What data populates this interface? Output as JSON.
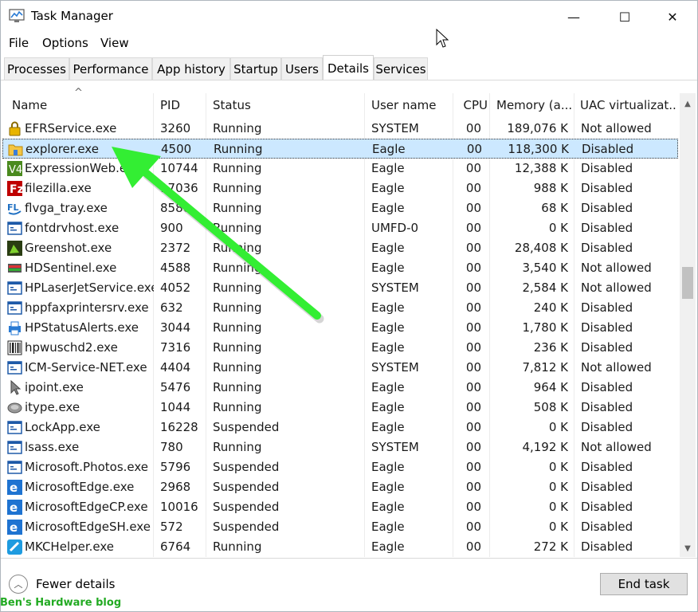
{
  "window": {
    "title": "Task Manager",
    "minimize": "—",
    "maximize": "☐",
    "close": "✕"
  },
  "menu": [
    "File",
    "Options",
    "View"
  ],
  "tabs": [
    "Processes",
    "Performance",
    "App history",
    "Startup",
    "Users",
    "Details",
    "Services"
  ],
  "active_tab": "Details",
  "columns": {
    "name": "Name",
    "pid": "PID",
    "status": "Status",
    "user": "User name",
    "cpu": "CPU",
    "memory": "Memory (a...",
    "uac": "UAC virtualizat..."
  },
  "sort_indicator": "^",
  "rows": [
    {
      "name": "EFRService.exe",
      "pid": "3260",
      "status": "Running",
      "user": "SYSTEM",
      "cpu": "00",
      "memory": "189,076 K",
      "uac": "Not allowed",
      "icon": "lock-icon",
      "selected": false
    },
    {
      "name": "explorer.exe",
      "pid": "4500",
      "status": "Running",
      "user": "Eagle",
      "cpu": "00",
      "memory": "118,300 K",
      "uac": "Disabled",
      "icon": "folder-icon",
      "selected": true
    },
    {
      "name": "ExpressionWeb.exe",
      "pid": "10744",
      "status": "Running",
      "user": "Eagle",
      "cpu": "00",
      "memory": "12,388 K",
      "uac": "Disabled",
      "icon": "expression-web-icon",
      "selected": false
    },
    {
      "name": "filezilla.exe",
      "pid": "17036",
      "status": "Running",
      "user": "Eagle",
      "cpu": "00",
      "memory": "988 K",
      "uac": "Disabled",
      "icon": "filezilla-icon",
      "selected": false
    },
    {
      "name": "flvga_tray.exe",
      "pid": "8580",
      "status": "Running",
      "user": "Eagle",
      "cpu": "00",
      "memory": "68 K",
      "uac": "Disabled",
      "icon": "flvga-icon",
      "selected": false
    },
    {
      "name": "fontdrvhost.exe",
      "pid": "900",
      "status": "Running",
      "user": "UMFD-0",
      "cpu": "00",
      "memory": "0 K",
      "uac": "Disabled",
      "icon": "window-app-icon",
      "selected": false
    },
    {
      "name": "Greenshot.exe",
      "pid": "2372",
      "status": "Running",
      "user": "Eagle",
      "cpu": "00",
      "memory": "28,408 K",
      "uac": "Disabled",
      "icon": "greenshot-icon",
      "selected": false
    },
    {
      "name": "HDSentinel.exe",
      "pid": "4588",
      "status": "Running",
      "user": "Eagle",
      "cpu": "00",
      "memory": "3,540 K",
      "uac": "Not allowed",
      "icon": "hdsentinel-icon",
      "selected": false
    },
    {
      "name": "HPLaserJetService.exe",
      "pid": "4052",
      "status": "Running",
      "user": "SYSTEM",
      "cpu": "00",
      "memory": "2,584 K",
      "uac": "Not allowed",
      "icon": "window-app-icon",
      "selected": false
    },
    {
      "name": "hppfaxprintersrv.exe",
      "pid": "632",
      "status": "Running",
      "user": "Eagle",
      "cpu": "00",
      "memory": "240 K",
      "uac": "Disabled",
      "icon": "window-app-icon",
      "selected": false
    },
    {
      "name": "HPStatusAlerts.exe",
      "pid": "3044",
      "status": "Running",
      "user": "Eagle",
      "cpu": "00",
      "memory": "1,780 K",
      "uac": "Disabled",
      "icon": "printer-icon",
      "selected": false
    },
    {
      "name": "hpwuschd2.exe",
      "pid": "7316",
      "status": "Running",
      "user": "Eagle",
      "cpu": "00",
      "memory": "236 K",
      "uac": "Disabled",
      "icon": "barcode-icon",
      "selected": false
    },
    {
      "name": "ICM-Service-NET.exe",
      "pid": "4404",
      "status": "Running",
      "user": "SYSTEM",
      "cpu": "00",
      "memory": "7,812 K",
      "uac": "Not allowed",
      "icon": "window-app-icon",
      "selected": false
    },
    {
      "name": "ipoint.exe",
      "pid": "5476",
      "status": "Running",
      "user": "Eagle",
      "cpu": "00",
      "memory": "964 K",
      "uac": "Disabled",
      "icon": "pointer-icon",
      "selected": false
    },
    {
      "name": "itype.exe",
      "pid": "1044",
      "status": "Running",
      "user": "Eagle",
      "cpu": "00",
      "memory": "508 K",
      "uac": "Disabled",
      "icon": "keyboard-icon",
      "selected": false
    },
    {
      "name": "LockApp.exe",
      "pid": "16228",
      "status": "Suspended",
      "user": "Eagle",
      "cpu": "00",
      "memory": "0 K",
      "uac": "Disabled",
      "icon": "window-app-icon",
      "selected": false
    },
    {
      "name": "lsass.exe",
      "pid": "780",
      "status": "Running",
      "user": "SYSTEM",
      "cpu": "00",
      "memory": "4,192 K",
      "uac": "Not allowed",
      "icon": "window-app-icon",
      "selected": false
    },
    {
      "name": "Microsoft.Photos.exe",
      "pid": "5796",
      "status": "Suspended",
      "user": "Eagle",
      "cpu": "00",
      "memory": "0 K",
      "uac": "Disabled",
      "icon": "window-app-icon",
      "selected": false
    },
    {
      "name": "MicrosoftEdge.exe",
      "pid": "2968",
      "status": "Suspended",
      "user": "Eagle",
      "cpu": "00",
      "memory": "0 K",
      "uac": "Disabled",
      "icon": "edge-icon",
      "selected": false
    },
    {
      "name": "MicrosoftEdgeCP.exe",
      "pid": "10016",
      "status": "Suspended",
      "user": "Eagle",
      "cpu": "00",
      "memory": "0 K",
      "uac": "Disabled",
      "icon": "edge-icon",
      "selected": false
    },
    {
      "name": "MicrosoftEdgeSH.exe",
      "pid": "572",
      "status": "Suspended",
      "user": "Eagle",
      "cpu": "00",
      "memory": "0 K",
      "uac": "Disabled",
      "icon": "edge-icon",
      "selected": false
    },
    {
      "name": "MKCHelper.exe",
      "pid": "6764",
      "status": "Running",
      "user": "Eagle",
      "cpu": "00",
      "memory": "272 K",
      "uac": "Disabled",
      "icon": "mkc-icon",
      "selected": false
    }
  ],
  "footer": {
    "fewer_details": "Fewer details",
    "end_task": "End task"
  },
  "watermark": "Ben's Hardware blog",
  "colors": {
    "selection": "#cce8ff",
    "annotation_arrow": "#33ee33",
    "watermark": "#22aa22"
  }
}
